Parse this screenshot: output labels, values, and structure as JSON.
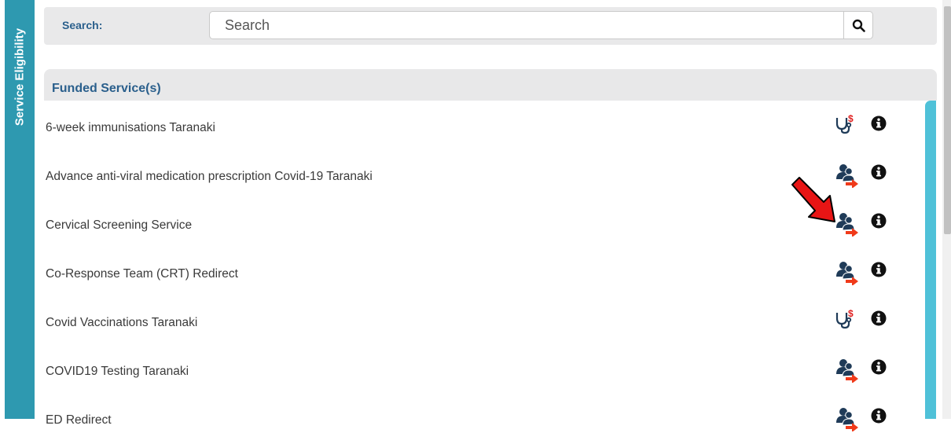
{
  "sidebar": {
    "tab_label": "Service Eligibility"
  },
  "search": {
    "label": "Search:",
    "placeholder": "Search",
    "button_icon": "search-icon"
  },
  "panel": {
    "title": "Funded Service(s)",
    "rows": [
      {
        "label": "6-week immunisations Taranaki",
        "icon": "stethoscope-funded-icon"
      },
      {
        "label": "Advance anti-viral medication prescription Covid-19 Taranaki",
        "icon": "referral-icon"
      },
      {
        "label": "Cervical Screening Service",
        "icon": "referral-icon"
      },
      {
        "label": "Co-Response Team (CRT) Redirect",
        "icon": "referral-icon"
      },
      {
        "label": "Covid Vaccinations Taranaki",
        "icon": "stethoscope-funded-icon"
      },
      {
        "label": "COVID19 Testing Taranaki",
        "icon": "referral-icon"
      },
      {
        "label": "ED Redirect",
        "icon": "referral-icon"
      }
    ]
  },
  "colors": {
    "sidebar": "#2e99b0",
    "accent": "#4fc1d8",
    "heading": "#2a5f8c",
    "icon": "#1f3b58",
    "alert": "#e02020"
  }
}
